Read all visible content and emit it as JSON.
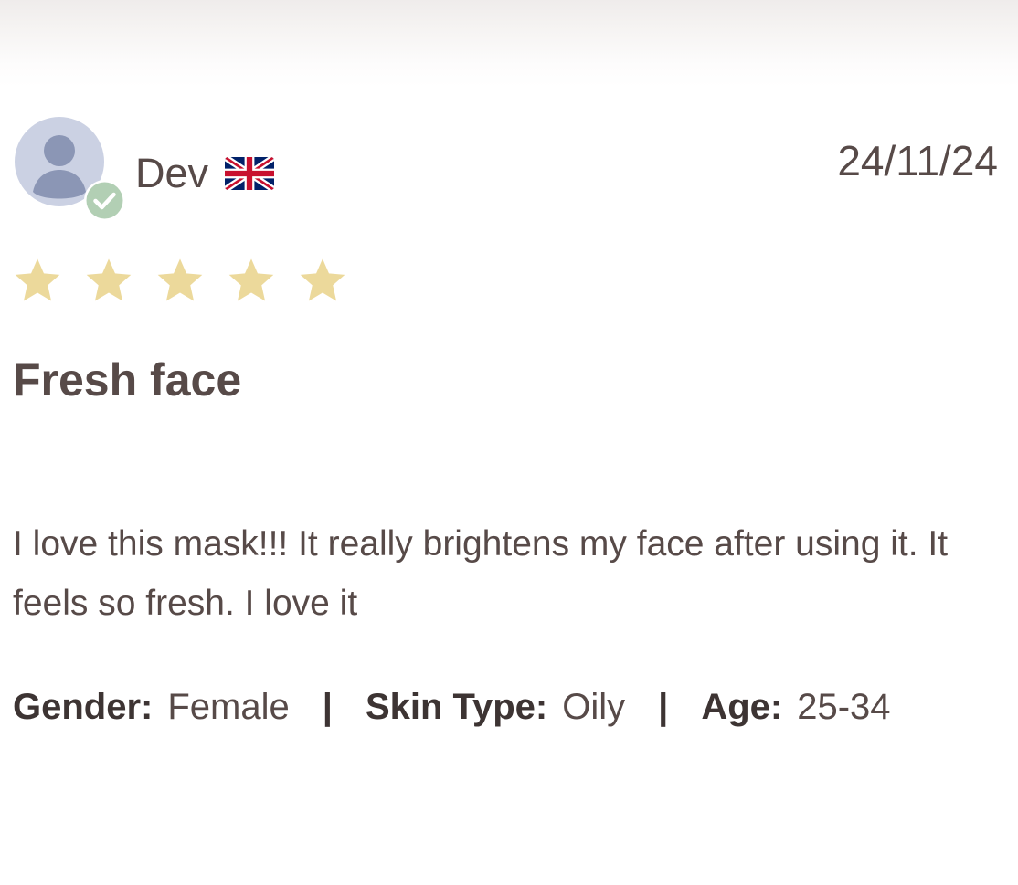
{
  "review": {
    "author": "Dev",
    "flag": "uk-flag-icon",
    "verified": true,
    "date": "24/11/24",
    "rating": 5,
    "rating_max": 5,
    "title": "Fresh face",
    "body": "I love this mask!!! It really brightens my face after using it. It feels so fresh. I love it",
    "attributes": {
      "gender_label": "Gender:",
      "gender_value": "Female",
      "skin_label": "Skin Type:",
      "skin_value": "Oily",
      "age_label": "Age:",
      "age_value": "25-34",
      "separator": "|"
    }
  },
  "colors": {
    "text": "#574a48",
    "star": "#ecd99b",
    "avatar_bg": "#cbd1e3",
    "avatar_figure": "#8b96b5",
    "verified_badge": "#b2cfb4"
  }
}
